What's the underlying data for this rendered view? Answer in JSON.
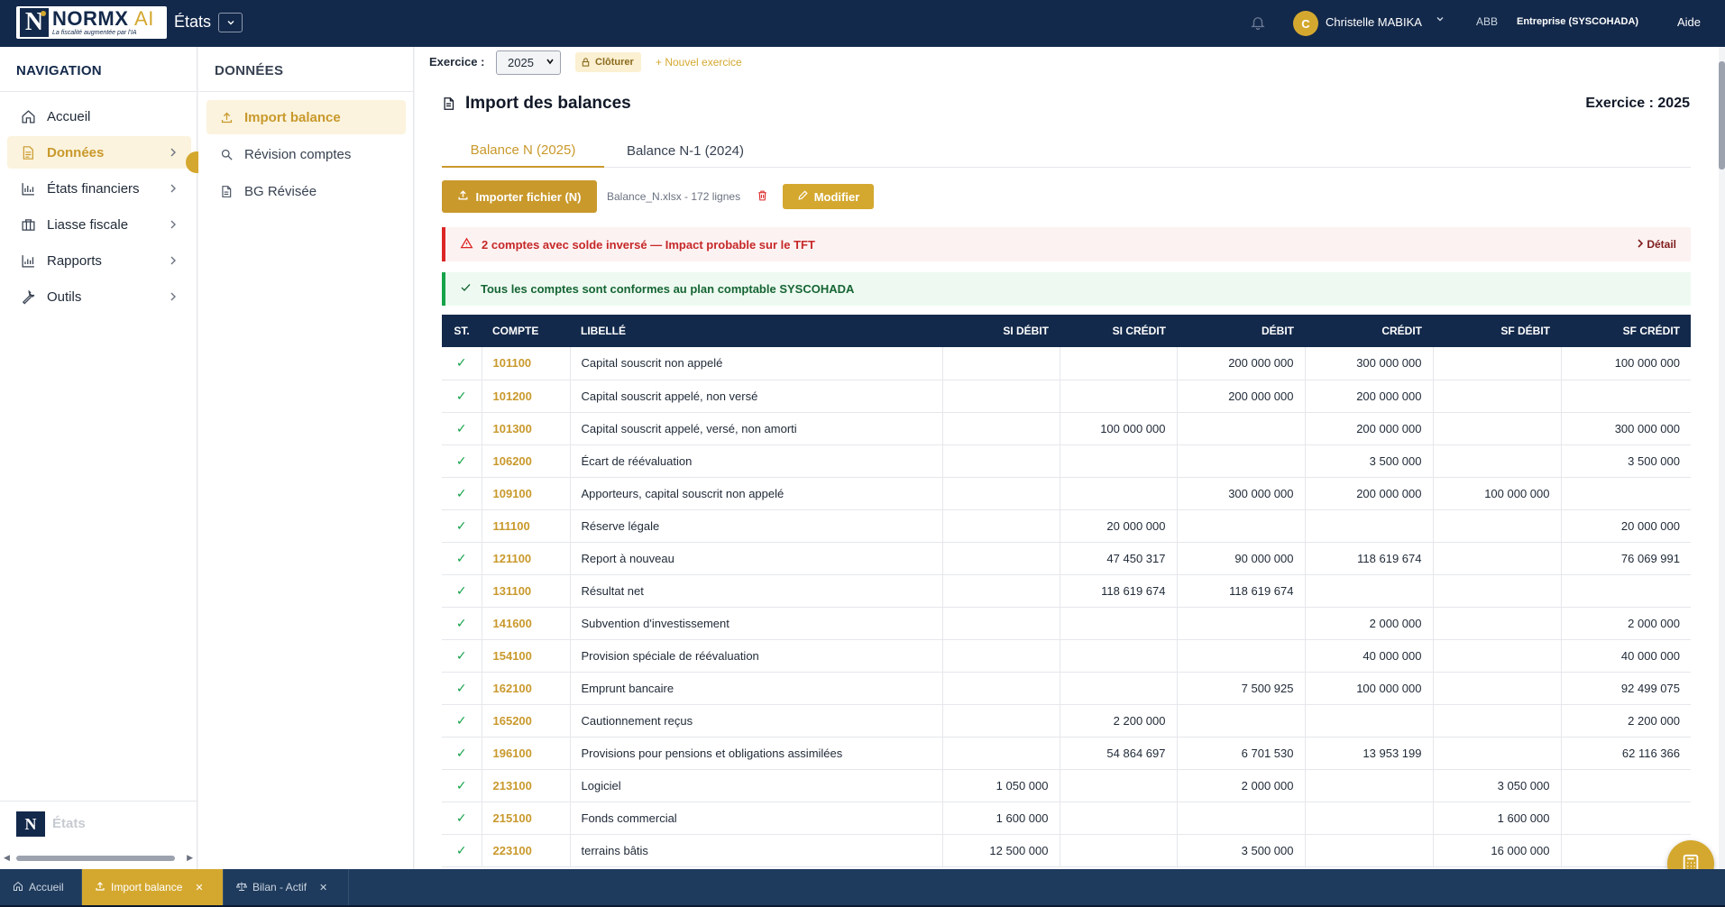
{
  "topbar": {
    "logo_name": "NORMX",
    "logo_ai": "AI",
    "logo_tagline": "La fiscalité augmentée par l'IA",
    "logo_mark": "N",
    "title": "États",
    "user_initial": "C",
    "user_name": "Christelle MABIKA",
    "org_code": "ABB",
    "entreprise": "Entreprise (SYSCOHADA)",
    "help": "Aide"
  },
  "nav": {
    "heading": "NAVIGATION",
    "items": [
      {
        "label": "Accueil",
        "icon": "home-icon"
      },
      {
        "label": "Données",
        "icon": "document-icon"
      },
      {
        "label": "États financiers",
        "icon": "chart-icon"
      },
      {
        "label": "Liasse fiscale",
        "icon": "briefcase-icon"
      },
      {
        "label": "Rapports",
        "icon": "bar-chart-icon"
      },
      {
        "label": "Outils",
        "icon": "wrench-icon"
      }
    ],
    "footer_label": "États",
    "footer_mark": "N"
  },
  "subnav": {
    "heading": "DONNÉES",
    "items": [
      {
        "label": "Import balance",
        "icon": "upload-icon"
      },
      {
        "label": "Révision comptes",
        "icon": "search-icon"
      },
      {
        "label": "BG Révisée",
        "icon": "file-icon"
      }
    ]
  },
  "exercice_bar": {
    "label": "Exercice :",
    "selected": "2025",
    "close_label": "Clôturer",
    "new_label": "+ Nouvel exercice"
  },
  "page": {
    "title": "Import des balances",
    "exercice_right": "Exercice : 2025"
  },
  "tabs": [
    {
      "label": "Balance N (2025)"
    },
    {
      "label": "Balance N-1 (2024)"
    }
  ],
  "toolbar": {
    "import_label": "Importer fichier (N)",
    "file_info": "Balance_N.xlsx - 172 lignes",
    "modify_label": "Modifier"
  },
  "alerts": {
    "error_text": "2 comptes avec solde inversé — Impact probable sur le TFT",
    "detail_label": "Détail",
    "success_text": "Tous les comptes sont conformes au plan comptable SYSCOHADA"
  },
  "table": {
    "headers": [
      "ST.",
      "COMPTE",
      "LIBELLÉ",
      "SI DÉBIT",
      "SI CRÉDIT",
      "DÉBIT",
      "CRÉDIT",
      "SF DÉBIT",
      "SF CRÉDIT"
    ],
    "rows": [
      {
        "st": "✓",
        "compte": "101100",
        "libelle": "Capital souscrit non appelé",
        "si_debit": "",
        "si_credit": "",
        "debit": "200 000 000",
        "credit": "300 000 000",
        "sf_debit": "",
        "sf_credit": "100 000 000"
      },
      {
        "st": "✓",
        "compte": "101200",
        "libelle": "Capital souscrit appelé, non versé",
        "si_debit": "",
        "si_credit": "",
        "debit": "200 000 000",
        "credit": "200 000 000",
        "sf_debit": "",
        "sf_credit": ""
      },
      {
        "st": "✓",
        "compte": "101300",
        "libelle": "Capital souscrit appelé, versé, non amorti",
        "si_debit": "",
        "si_credit": "100 000 000",
        "debit": "",
        "credit": "200 000 000",
        "sf_debit": "",
        "sf_credit": "300 000 000"
      },
      {
        "st": "✓",
        "compte": "106200",
        "libelle": "Écart de réévaluation",
        "si_debit": "",
        "si_credit": "",
        "debit": "",
        "credit": "3 500 000",
        "sf_debit": "",
        "sf_credit": "3 500 000"
      },
      {
        "st": "✓",
        "compte": "109100",
        "libelle": "Apporteurs, capital souscrit non appelé",
        "si_debit": "",
        "si_credit": "",
        "debit": "300 000 000",
        "credit": "200 000 000",
        "sf_debit": "100 000 000",
        "sf_credit": ""
      },
      {
        "st": "✓",
        "compte": "111100",
        "libelle": "Réserve légale",
        "si_debit": "",
        "si_credit": "20 000 000",
        "debit": "",
        "credit": "",
        "sf_debit": "",
        "sf_credit": "20 000 000"
      },
      {
        "st": "✓",
        "compte": "121100",
        "libelle": "Report à nouveau",
        "si_debit": "",
        "si_credit": "47 450 317",
        "debit": "90 000 000",
        "credit": "118 619 674",
        "sf_debit": "",
        "sf_credit": "76 069 991"
      },
      {
        "st": "✓",
        "compte": "131100",
        "libelle": "Résultat net",
        "si_debit": "",
        "si_credit": "118 619 674",
        "debit": "118 619 674",
        "credit": "",
        "sf_debit": "",
        "sf_credit": ""
      },
      {
        "st": "✓",
        "compte": "141600",
        "libelle": "Subvention d'investissement",
        "si_debit": "",
        "si_credit": "",
        "debit": "",
        "credit": "2 000 000",
        "sf_debit": "",
        "sf_credit": "2 000 000"
      },
      {
        "st": "✓",
        "compte": "154100",
        "libelle": "Provision spéciale de réévaluation",
        "si_debit": "",
        "si_credit": "",
        "debit": "",
        "credit": "40 000 000",
        "sf_debit": "",
        "sf_credit": "40 000 000"
      },
      {
        "st": "✓",
        "compte": "162100",
        "libelle": "Emprunt bancaire",
        "si_debit": "",
        "si_credit": "",
        "debit": "7 500 925",
        "credit": "100 000 000",
        "sf_debit": "",
        "sf_credit": "92 499 075"
      },
      {
        "st": "✓",
        "compte": "165200",
        "libelle": "Cautionnement reçus",
        "si_debit": "",
        "si_credit": "2 200 000",
        "debit": "",
        "credit": "",
        "sf_debit": "",
        "sf_credit": "2 200 000"
      },
      {
        "st": "✓",
        "compte": "196100",
        "libelle": "Provisions pour pensions et obligations assimilées",
        "si_debit": "",
        "si_credit": "54 864 697",
        "debit": "6 701 530",
        "credit": "13 953 199",
        "sf_debit": "",
        "sf_credit": "62 116 366"
      },
      {
        "st": "✓",
        "compte": "213100",
        "libelle": "Logiciel",
        "si_debit": "1 050 000",
        "si_credit": "",
        "debit": "2 000 000",
        "credit": "",
        "sf_debit": "3 050 000",
        "sf_credit": ""
      },
      {
        "st": "✓",
        "compte": "215100",
        "libelle": "Fonds commercial",
        "si_debit": "1 600 000",
        "si_credit": "",
        "debit": "",
        "credit": "",
        "sf_debit": "1 600 000",
        "sf_credit": ""
      },
      {
        "st": "✓",
        "compte": "223100",
        "libelle": "terrains bâtis",
        "si_debit": "12 500 000",
        "si_credit": "",
        "debit": "3 500 000",
        "credit": "",
        "sf_debit": "16 000 000",
        "sf_credit": ""
      }
    ]
  },
  "bottom_tabs": [
    {
      "label": "Accueil",
      "icon": "home-icon",
      "closable": false
    },
    {
      "label": "Import balance",
      "icon": "upload-icon",
      "closable": true
    },
    {
      "label": "Bilan - Actif",
      "icon": "scale-icon",
      "closable": true
    }
  ],
  "colors": {
    "navy": "#13294b",
    "gold": "#d4a82f",
    "gold_dark": "#c9992c",
    "error": "#dc2626",
    "success": "#16a34a"
  }
}
